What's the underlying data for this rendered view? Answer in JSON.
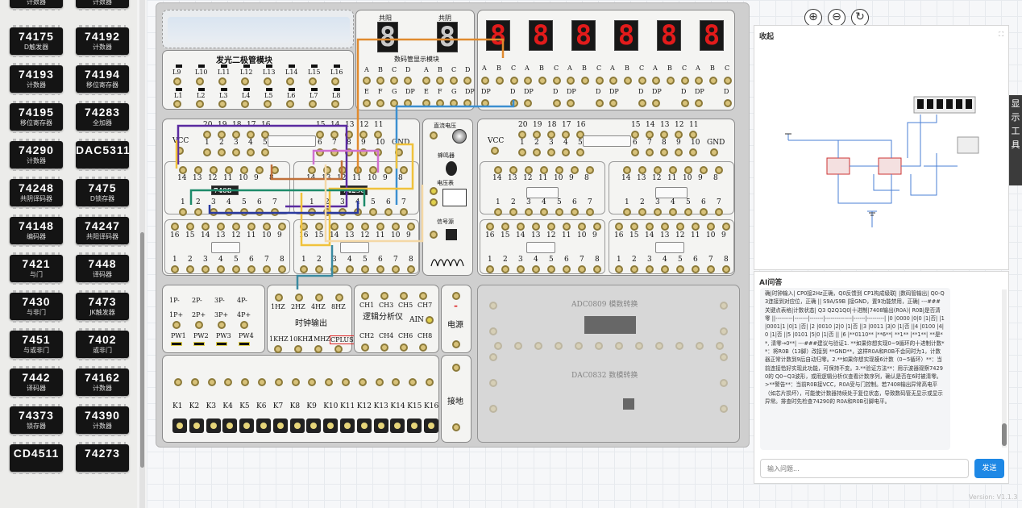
{
  "palette": {
    "chips": [
      {
        "num": "74175",
        "desc": "D触发器"
      },
      {
        "num": "74192",
        "desc": "计数器"
      },
      {
        "num": "74193",
        "desc": "计数器"
      },
      {
        "num": "74194",
        "desc": "移位寄存器"
      },
      {
        "num": "74195",
        "desc": "移位寄存器"
      },
      {
        "num": "74283",
        "desc": "全加器"
      },
      {
        "num": "74290",
        "desc": "计数器"
      },
      {
        "num": "DAC5311",
        "desc": ""
      },
      {
        "num": "74248",
        "desc": "共阴译码器"
      },
      {
        "num": "7475",
        "desc": "D锁存器"
      },
      {
        "num": "74148",
        "desc": "编码器"
      },
      {
        "num": "74247",
        "desc": "共阳译码器"
      },
      {
        "num": "7421",
        "desc": "与门"
      },
      {
        "num": "7448",
        "desc": "译码器"
      },
      {
        "num": "7430",
        "desc": "与非门"
      },
      {
        "num": "7473",
        "desc": "JK触发器"
      },
      {
        "num": "7451",
        "desc": "与或非门"
      },
      {
        "num": "7402",
        "desc": "或非门"
      },
      {
        "num": "7442",
        "desc": "译码器"
      },
      {
        "num": "74162",
        "desc": "计数器"
      },
      {
        "num": "74373",
        "desc": "锁存器"
      },
      {
        "num": "74390",
        "desc": "计数器"
      },
      {
        "num": "CD4511",
        "desc": ""
      },
      {
        "num": "74273",
        "desc": ""
      }
    ],
    "top_partial": [
      "计数器",
      "计数器"
    ]
  },
  "board": {
    "led_title": "发光二极管模块",
    "led_row1": [
      "L9",
      "L10",
      "L11",
      "L12",
      "L13",
      "L14",
      "L15",
      "L16"
    ],
    "led_row2": [
      "L1",
      "L2",
      "L3",
      "L4",
      "L5",
      "L6",
      "L7",
      "L8"
    ],
    "seg_anode": "共阳",
    "seg_cathode": "共阴",
    "seg_title": "数码管显示模块",
    "seg_digit": "8",
    "seg_abcd": [
      "A",
      "B",
      "C",
      "D"
    ],
    "seg_efgdp": [
      "E",
      "F",
      "G",
      "DP"
    ],
    "big_abc": [
      "A",
      "B",
      "C"
    ],
    "big_d_dp": [
      "DP",
      "D"
    ],
    "ic_top_pins": [
      "20",
      "19",
      "18",
      "17",
      "16"
    ],
    "ic_top_pins2": [
      "15",
      "14",
      "13",
      "12",
      "11"
    ],
    "ic_bot_pins": [
      "1",
      "2",
      "3",
      "4",
      "5"
    ],
    "ic_bot_pins2": [
      "6",
      "7",
      "8",
      "9",
      "10"
    ],
    "vcc": "VCC",
    "gnd": "GND",
    "p14": [
      "14",
      "13",
      "12",
      "11",
      "10",
      "9",
      "8"
    ],
    "p7": [
      "1",
      "2",
      "3",
      "4",
      "5",
      "6",
      "7"
    ],
    "p16": [
      "16",
      "15",
      "14",
      "13",
      "12",
      "11",
      "10",
      "9"
    ],
    "p8": [
      "1",
      "2",
      "3",
      "4",
      "5",
      "6",
      "7",
      "8"
    ],
    "chip_a": "7408",
    "chip_b": "74290",
    "dc_label": "直流电压",
    "buzzer_label": "蜂鸣器",
    "voltmeter_label": "电压表",
    "signal_label": "信号源",
    "pw_top": [
      "1P-",
      "2P-",
      "3P-",
      "4P-"
    ],
    "pw_mid": [
      "1P+",
      "2P+",
      "3P+",
      "4P+"
    ],
    "pw_bot": [
      "PW1",
      "PW2",
      "PW3",
      "PW4"
    ],
    "clk_top": [
      "1HZ",
      "2HZ",
      "4HZ",
      "8HZ"
    ],
    "clk_title": "时钟输出",
    "clk_bot": [
      "1KHZ",
      "10KHZ",
      "1MHZ",
      "CPLUS"
    ],
    "la_top": [
      "CH1",
      "CH3",
      "CH5",
      "CH7"
    ],
    "la_title": "逻辑分析仪",
    "la_ain": "AIN",
    "la_bot": [
      "CH2",
      "CH4",
      "CH6",
      "CH8"
    ],
    "power_label": "电源",
    "power_sign": "-",
    "ground_label": "接地",
    "keys": [
      "K1",
      "K2",
      "K3",
      "K4",
      "K5",
      "K6",
      "K7",
      "K8",
      "K9",
      "K10",
      "K11",
      "K12",
      "K13",
      "K14",
      "K15",
      "K16"
    ],
    "adc_title": "ADC0809 模数转换",
    "dac_title": "DAC0832 数模转换"
  },
  "toolbar": {
    "zoom_in": "⊕",
    "zoom_out": "⊖",
    "reset": "↻"
  },
  "mini": {
    "title": "收起",
    "expand": "⛶"
  },
  "side_tab": "显示工具",
  "ai": {
    "title": "AI问答",
    "message": "确|时钟输入| CP0接2Hz正确，Q0反馈到 CP1构成级联| |数码管输出| Q0-Q3连接到对应位，正确 || S9A/S9B |接GND，置9功能禁用，正确| ---###关键点表格|计数状态| Q3 Q2Q1Q0|十进制|7408输出(R0A)| R0B|是否清零 ||---------|-------|-------|--------------|------|---------| |0 |0000 |0|0 |1|否| |1|0001|1 |0|1 |否| |2 |0010 |2|0 |1|否 ||3 |0011 |3|0 |1|否 ||4 |0100 |4|0 |1|否 ||5 |0101 |5|0 |1|否 || |6 |**0110** |**6**| **1** |**1**| **是**, 清零→0**| ---###建议与验证1. **如果你想实现0~9循环的十进制计数**：将R0B（13脚）改接到 **GND**，这样R0A和R0B不会同时为1，计数器正常计数到9后自动归零。2.**如果你想实现模6计数（0~5循环）**：当前连接恰好实现此功能，可保持不变。3.**验证方法**：用示波器观察74290的 Q0~Q3波形，或用逻辑分析仪查看计数序列，确认是否在6时被清零。 >**警告**：当前R0B接VCC，R0A受与门控制。若7408输出异常高电平（如芯片损坏），可能使计数器持续处于复位状态，导致数码管无显示或显示异常。排查时先检查74290的 R0A和R0B引脚电平。",
    "input_placeholder": "输入问题...",
    "send_label": "发送"
  },
  "version": "Version: V1.1.3",
  "colors": {
    "segment_red": "#e21b1b",
    "accent_blue": "#1e88e5"
  }
}
